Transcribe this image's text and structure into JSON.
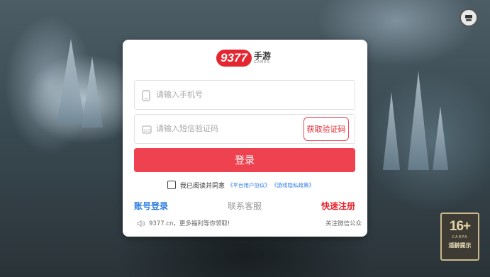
{
  "brand": {
    "logo_number": "9377",
    "logo_cn": "手游",
    "logo_en": "GAMES"
  },
  "login": {
    "phone_placeholder": "请输入手机号",
    "code_placeholder": "请输入短信验证码",
    "get_code_label": "获取验证码",
    "submit_label": "登录",
    "agree_text": "我已阅读并同意",
    "user_agreement": "《平台用户协议》",
    "privacy_policy": "《游戏隐私政策》",
    "account_login": "账号登录",
    "customer_service": "联系客服",
    "quick_register": "快速注册",
    "notice": "9377.cn，更多福利等你领取!",
    "wechat": "关注微信公众"
  },
  "age_rating": {
    "age": "16+",
    "org": "CADPA",
    "tip": "适龄提示"
  },
  "colors": {
    "brand_red": "#e3262f",
    "login_button": "#ee4250",
    "link_blue": "#2f7de1"
  },
  "icons": [
    "phone-icon",
    "sms-code-icon",
    "speaker-icon",
    "user-center-icon"
  ]
}
